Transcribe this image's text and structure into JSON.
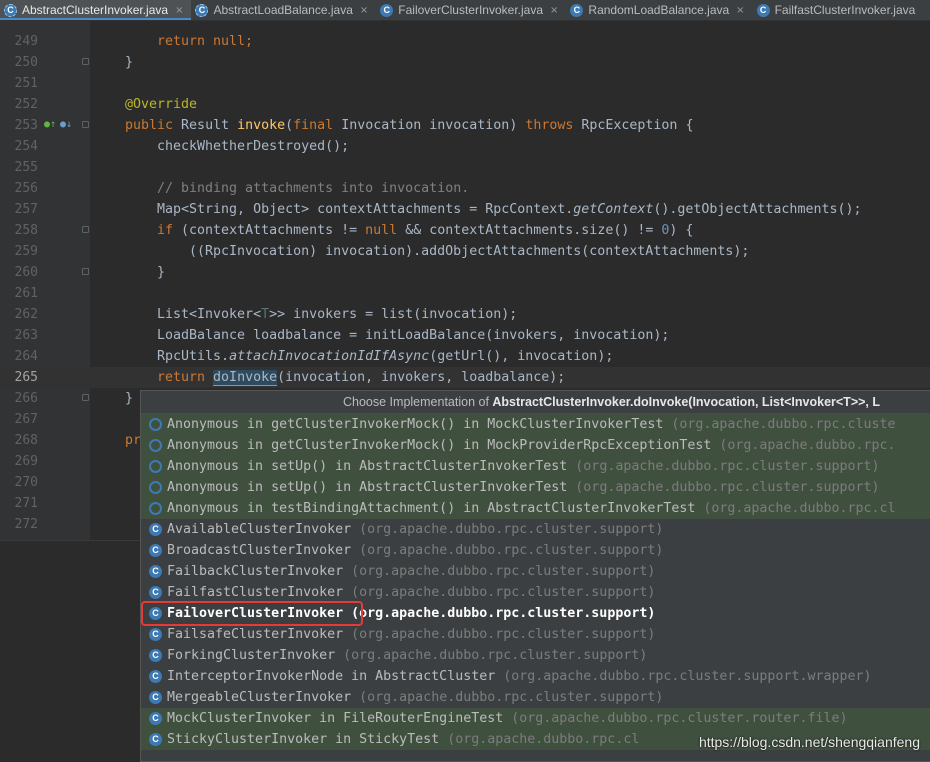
{
  "tabs": [
    {
      "label": "AbstractClusterInvoker.java",
      "icon": "abstract-class-icon",
      "active": true
    },
    {
      "label": "AbstractLoadBalance.java",
      "icon": "abstract-class-icon",
      "active": false
    },
    {
      "label": "FailoverClusterInvoker.java",
      "icon": "class-icon",
      "active": false
    },
    {
      "label": "RandomLoadBalance.java",
      "icon": "class-icon",
      "active": false
    },
    {
      "label": "FailfastClusterInvoker.java",
      "icon": "class-icon",
      "active": false
    }
  ],
  "tab_close_glyph": "×",
  "class_icon_letter": "C",
  "line_numbers": [
    "249",
    "250",
    "251",
    "252",
    "253",
    "254",
    "255",
    "256",
    "257",
    "258",
    "259",
    "260",
    "261",
    "262",
    "263",
    "264",
    "265",
    "266",
    "267",
    "268",
    "269",
    "270",
    "271",
    "272"
  ],
  "code": {
    "l249": "return null;",
    "l250": "}",
    "l252": "@Override",
    "l253": "public Result invoke(final Invocation invocation) throws RpcException {",
    "l254": "checkWhetherDestroyed();",
    "l256": "// binding attachments into invocation.",
    "l257": "Map<String, Object> contextAttachments = RpcContext.getContext().getObjectAttachments();",
    "l258": "if (contextAttachments != null && contextAttachments.size() != 0) {",
    "l259": "((RpcInvocation) invocation).addObjectAttachments(contextAttachments);",
    "l260": "}",
    "l262": "List<Invoker<T>> invokers = list(invocation);",
    "l263": "LoadBalance loadbalance = initLoadBalance(invokers, invocation);",
    "l264": "RpcUtils.attachInvocationIdIfAsync(getUrl(), invocation);",
    "l265": "return doInvoke(invocation, invokers, loadbalance);",
    "l266": "}",
    "l268": "pr"
  },
  "popup": {
    "title_prefix": "Choose Implementation of ",
    "title_bold": "AbstractClusterInvoker.doInvoke(Invocation, List<Invoker<T>>, L",
    "items": [
      {
        "name": "Anonymous in getClusterInvokerMock() in MockClusterInvokerTest",
        "pkg": "(org.apache.dubbo.rpc.cluste",
        "test": true,
        "anon": true
      },
      {
        "name": "Anonymous in getClusterInvokerMock() in MockProviderRpcExceptionTest",
        "pkg": "(org.apache.dubbo.rpc.",
        "test": true,
        "anon": true
      },
      {
        "name": "Anonymous in setUp() in AbstractClusterInvokerTest",
        "pkg": "(org.apache.dubbo.rpc.cluster.support)",
        "test": true,
        "anon": true
      },
      {
        "name": "Anonymous in setUp() in AbstractClusterInvokerTest",
        "pkg": "(org.apache.dubbo.rpc.cluster.support)",
        "test": true,
        "anon": true
      },
      {
        "name": "Anonymous in testBindingAttachment() in AbstractClusterInvokerTest",
        "pkg": "(org.apache.dubbo.rpc.cl",
        "test": true,
        "anon": true
      },
      {
        "name": "AvailableClusterInvoker",
        "pkg": "(org.apache.dubbo.rpc.cluster.support)",
        "test": false,
        "anon": false
      },
      {
        "name": "BroadcastClusterInvoker",
        "pkg": "(org.apache.dubbo.rpc.cluster.support)",
        "test": false,
        "anon": false
      },
      {
        "name": "FailbackClusterInvoker",
        "pkg": "(org.apache.dubbo.rpc.cluster.support)",
        "test": false,
        "anon": false
      },
      {
        "name": "FailfastClusterInvoker",
        "pkg": "(org.apache.dubbo.rpc.cluster.support)",
        "test": false,
        "anon": false
      },
      {
        "name": "FailoverClusterInvoker",
        "pkg": "(org.apache.dubbo.rpc.cluster.support)",
        "test": false,
        "anon": false,
        "selected": true
      },
      {
        "name": "FailsafeClusterInvoker",
        "pkg": "(org.apache.dubbo.rpc.cluster.support)",
        "test": false,
        "anon": false
      },
      {
        "name": "ForkingClusterInvoker",
        "pkg": "(org.apache.dubbo.rpc.cluster.support)",
        "test": false,
        "anon": false
      },
      {
        "name": "InterceptorInvokerNode in AbstractCluster",
        "pkg": "(org.apache.dubbo.rpc.cluster.support.wrapper)",
        "test": false,
        "anon": false
      },
      {
        "name": "MergeableClusterInvoker",
        "pkg": "(org.apache.dubbo.rpc.cluster.support)",
        "test": false,
        "anon": false
      },
      {
        "name": "MockClusterInvoker in FileRouterEngineTest",
        "pkg": "(org.apache.dubbo.rpc.cluster.router.file)",
        "test": true,
        "anon": false
      },
      {
        "name": "StickyClusterInvoker in StickyTest",
        "pkg": "(org.apache.dubbo.rpc.cl",
        "test": true,
        "anon": false
      }
    ]
  },
  "watermark": "https://blog.csdn.net/shengqianfeng",
  "colors": {
    "keyword": "#cc7832",
    "annotation": "#bbb529",
    "method": "#ffc66d",
    "number": "#6897bb",
    "comment": "#808080",
    "highlight_box": "#e43a3a"
  }
}
